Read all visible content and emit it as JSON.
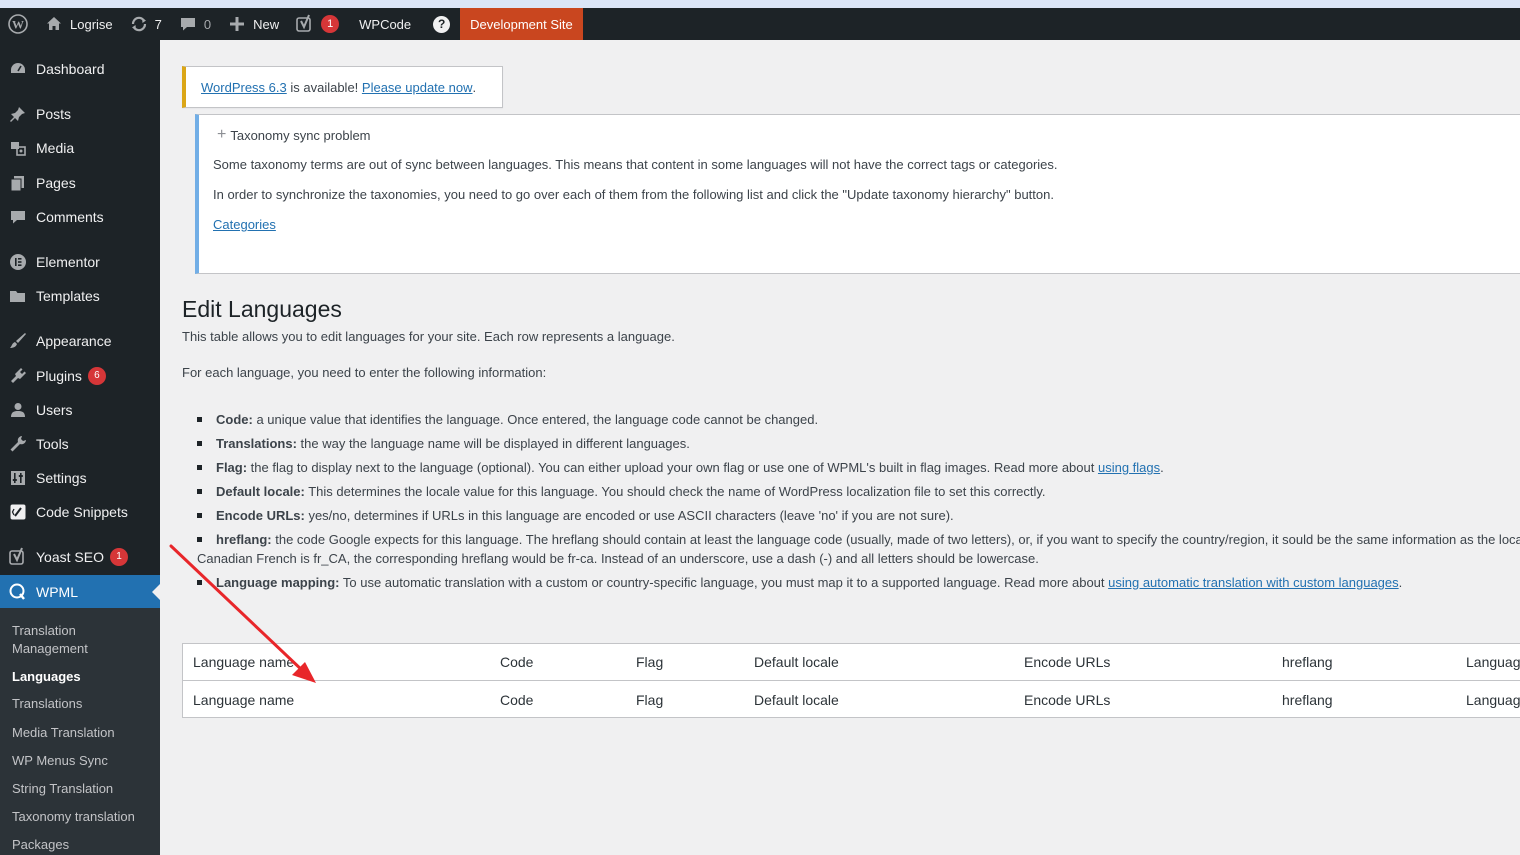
{
  "admin_bar": {
    "site_name": "Logrise",
    "updates_count": "7",
    "comments_count": "0",
    "new_label": "New",
    "yoast_badge": "1",
    "wpcode_label": "WPCode",
    "help_label": "?",
    "dev_site_label": "Development Site"
  },
  "sidebar": {
    "items": [
      {
        "label": "Dashboard"
      },
      {
        "label": "Posts"
      },
      {
        "label": "Media"
      },
      {
        "label": "Pages"
      },
      {
        "label": "Comments"
      },
      {
        "label": "Elementor"
      },
      {
        "label": "Templates"
      },
      {
        "label": "Appearance"
      },
      {
        "label": "Plugins",
        "badge": "6"
      },
      {
        "label": "Users"
      },
      {
        "label": "Tools"
      },
      {
        "label": "Settings"
      },
      {
        "label": "Code Snippets"
      },
      {
        "label": "Yoast SEO",
        "badge": "1"
      },
      {
        "label": "WPML"
      }
    ],
    "submenu": [
      {
        "label": "Translation Management"
      },
      {
        "label": "Languages"
      },
      {
        "label": "Translations"
      },
      {
        "label": "Media Translation"
      },
      {
        "label": "WP Menus Sync"
      },
      {
        "label": "String Translation"
      },
      {
        "label": "Taxonomy translation"
      },
      {
        "label": "Packages"
      }
    ]
  },
  "update_nag": {
    "version_link": "WordPress 6.3",
    "middle_text": " is available! ",
    "update_link": "Please update now",
    "end_text": "."
  },
  "taxonomy_notice": {
    "title": "Taxonomy sync problem",
    "line1": "Some taxonomy terms are out of sync between languages. This means that content in some languages will not have the correct tags or categories.",
    "line2": "In order to synchronize the taxonomies, you need to go over each of them from the following list and click the \"Update taxonomy hierarchy\" button.",
    "categories_link": "Categories"
  },
  "page": {
    "title": "Edit Languages",
    "intro": "This table allows you to edit languages for your site. Each row represents a language.",
    "for_each": "For each language, you need to enter the following information:",
    "bullets": {
      "code_term": "Code:",
      "code_desc": " a unique value that identifies the language. Once entered, the language code cannot be changed.",
      "translations_term": "Translations:",
      "translations_desc": " the way the language name will be displayed in different languages.",
      "flag_term": "Flag:",
      "flag_desc": " the flag to display next to the language (optional). You can either upload your own flag or use one of WPML's built in flag images. Read more about ",
      "flag_link": "using flags",
      "flag_end": ".",
      "locale_term": "Default locale:",
      "locale_desc": " This determines the locale value for this language. You should check the name of WordPress localization file to set this correctly.",
      "encode_term": "Encode URLs:",
      "encode_desc": " yes/no, determines if URLs in this language are encoded or use ASCII characters (leave 'no' if you are not sure).",
      "hreflang_term": "hreflang:",
      "hreflang_desc": " the code Google expects for this language. The hreflang should contain at least the language code (usually, made of two letters), or, if you want to specify the country/region, it sould be the same information as the loca",
      "hreflang_cont": "Canadian French is fr_CA, the corresponding hreflang would be fr-ca. Instead of an underscore, use a dash (-) and all letters should be lowercase.",
      "mapping_term": "Language mapping:",
      "mapping_desc": " To use automatic translation with a custom or country-specific language, you must map it to a supported language. Read more about ",
      "mapping_link": "using automatic translation with custom languages",
      "mapping_end": "."
    }
  },
  "table": {
    "header": [
      "Language name",
      "Code",
      "Flag",
      "Default locale",
      "Encode URLs",
      "hreflang",
      "Language"
    ],
    "footer": [
      "Language name",
      "Code",
      "Flag",
      "Default locale",
      "Encode URLs",
      "hreflang",
      "Language"
    ]
  },
  "colors": {
    "admin_bar": "#1d2327",
    "accent": "#2271b1",
    "dev_site": "#c9461f",
    "badge": "#d63638",
    "arrow": "#e8262a"
  }
}
